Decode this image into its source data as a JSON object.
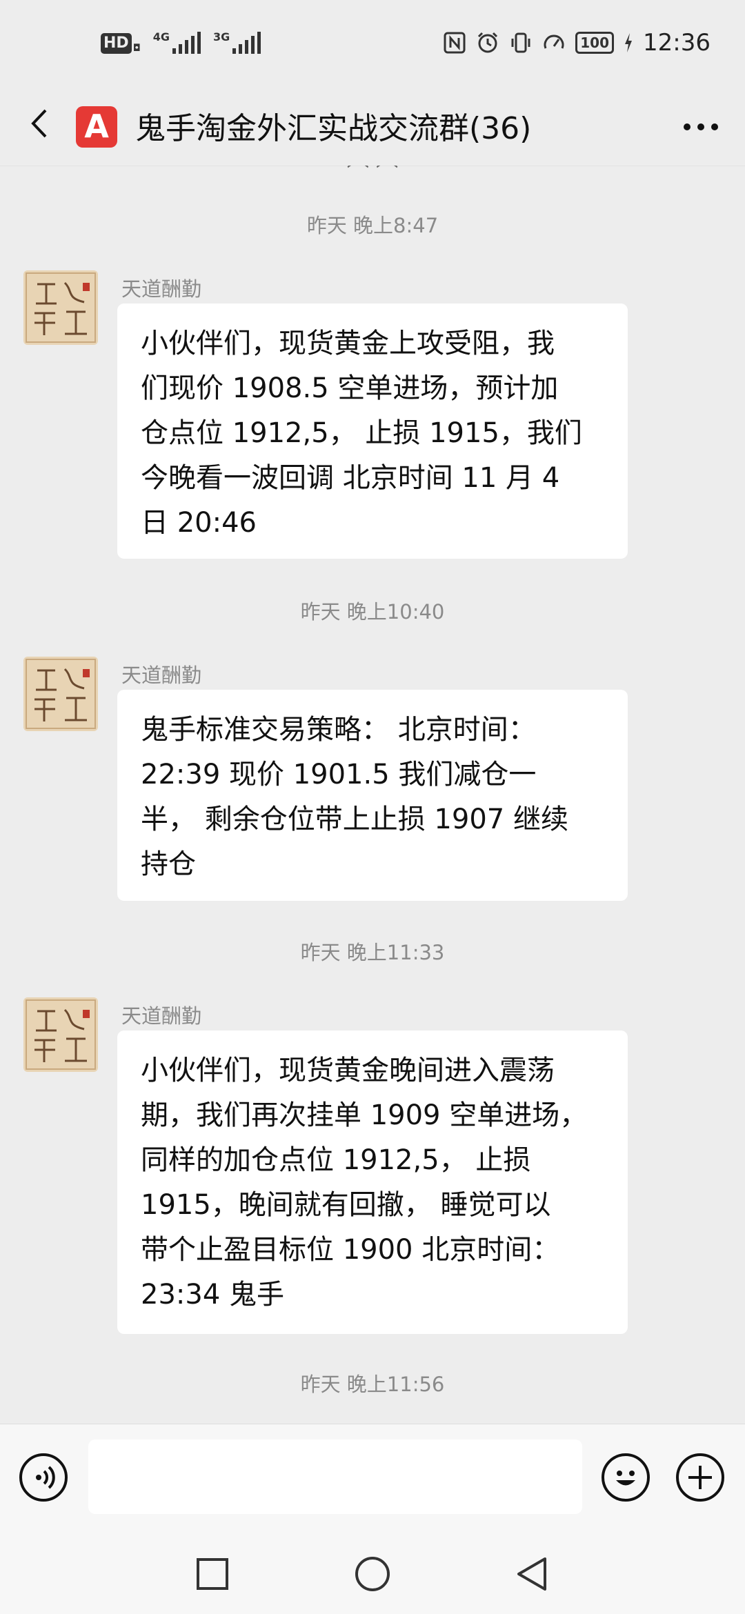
{
  "status_bar": {
    "hd_label": "HD",
    "signal_1_network": "4G",
    "signal_2_network": "3G",
    "battery_level": "100",
    "time": "12:36"
  },
  "header": {
    "app_icon_letter": "A",
    "title": "鬼手淘金外汇实战交流群(36)"
  },
  "chat": {
    "messages": [
      {
        "timestamp": "昨天 晚上8:47",
        "sender": "天道酬勤",
        "text": "小伙伴们，现货黄金上攻受阻，我\n们现价 1908.5 空单进场，预计加\n仓点位 1912,5，  止损 1915，我们\n今晚看一波回调    北京时间 11 月 4\n日 20:46"
      },
      {
        "timestamp": "昨天 晚上10:40",
        "sender": "天道酬勤",
        "text": "鬼手标准交易策略：  北京时间：\n22:39    现价 1901.5 我们减仓一\n半，  剩余仓位带上止损 1907 继续\n持仓"
      },
      {
        "timestamp": "昨天 晚上11:33",
        "sender": "天道酬勤",
        "text": "小伙伴们，现货黄金晚间进入震荡\n期，我们再次挂单 1909 空单进场，\n同样的加仓点位 1912,5，  止损\n1915，晚间就有回撤，  睡觉可以\n带个止盈目标位 1900     北京时间：\n23:34        鬼手"
      }
    ],
    "last_timestamp": "昨天 晚上11:56"
  },
  "input_bar": {
    "placeholder": ""
  },
  "colors": {
    "background": "#ededed",
    "bubble": "#ffffff",
    "timestamp_text": "#8a8a8a",
    "app_icon": "#e53935"
  },
  "icons": [
    "back-arrow-icon",
    "more-icon",
    "voice-icon",
    "emoji-icon",
    "plus-icon",
    "nav-square-icon",
    "nav-circle-icon",
    "nav-back-icon"
  ]
}
